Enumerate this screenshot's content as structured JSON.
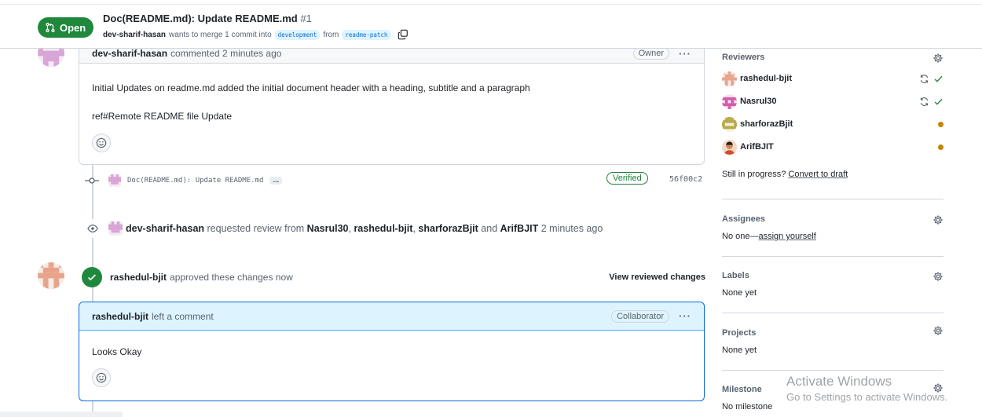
{
  "header": {
    "state": "Open",
    "title": "Doc(README.md): Update README.md",
    "number": "#1",
    "author": "dev-sharif-hasan",
    "merge_text": "wants to merge 1 commit into",
    "base_branch": "development",
    "from_text": "from",
    "head_branch": "readme-patch"
  },
  "comment1": {
    "author": "dev-sharif-hasan",
    "time": "commented 2 minutes ago",
    "role": "Owner",
    "body_line1": "Initial Updates on readme.md added the initial document header with a heading, subtitle and a paragraph",
    "body_line2": "ref#Remote README file Update"
  },
  "commit": {
    "message": "Doc(README.md): Update README.md",
    "ellipsis": "…",
    "verified": "Verified",
    "sha": "56f00c2"
  },
  "review_request": {
    "actor": "dev-sharif-hasan",
    "text1": "requested review from",
    "r1": "Nasrul30",
    "r2": "rashedul-bjit",
    "r3": "sharforazBjit",
    "and_text": "and",
    "r4": "ArifBJIT",
    "time": "2 minutes ago"
  },
  "approval": {
    "actor": "rashedul-bjit",
    "text": "approved these changes now",
    "view_changes": "View reviewed changes"
  },
  "comment2": {
    "author": "rashedul-bjit",
    "action": "left a comment",
    "role": "Collaborator",
    "body": "Looks Okay"
  },
  "sidebar": {
    "reviewers_heading": "Reviewers",
    "reviewers": [
      {
        "name": "rashedul-bjit",
        "status": "approved"
      },
      {
        "name": "Nasrul30",
        "status": "approved"
      },
      {
        "name": "sharforazBjit",
        "status": "pending"
      },
      {
        "name": "ArifBJIT",
        "status": "pending"
      }
    ],
    "draft_text": "Still in progress?",
    "draft_link": "Convert to draft",
    "assignees_heading": "Assignees",
    "assignees_text": "No one—",
    "assignees_link": "assign yourself",
    "labels_heading": "Labels",
    "labels_value": "None yet",
    "projects_heading": "Projects",
    "projects_value": "None yet",
    "milestone_heading": "Milestone",
    "milestone_value": "No milestone"
  },
  "watermark": {
    "line1": "Activate Windows",
    "line2": "Go to Settings to activate Windows."
  },
  "colors": {
    "open_green": "#1f883d",
    "link_blue": "#0969da",
    "pending": "#bf8700",
    "highlight_bg": "#ddf4ff"
  }
}
